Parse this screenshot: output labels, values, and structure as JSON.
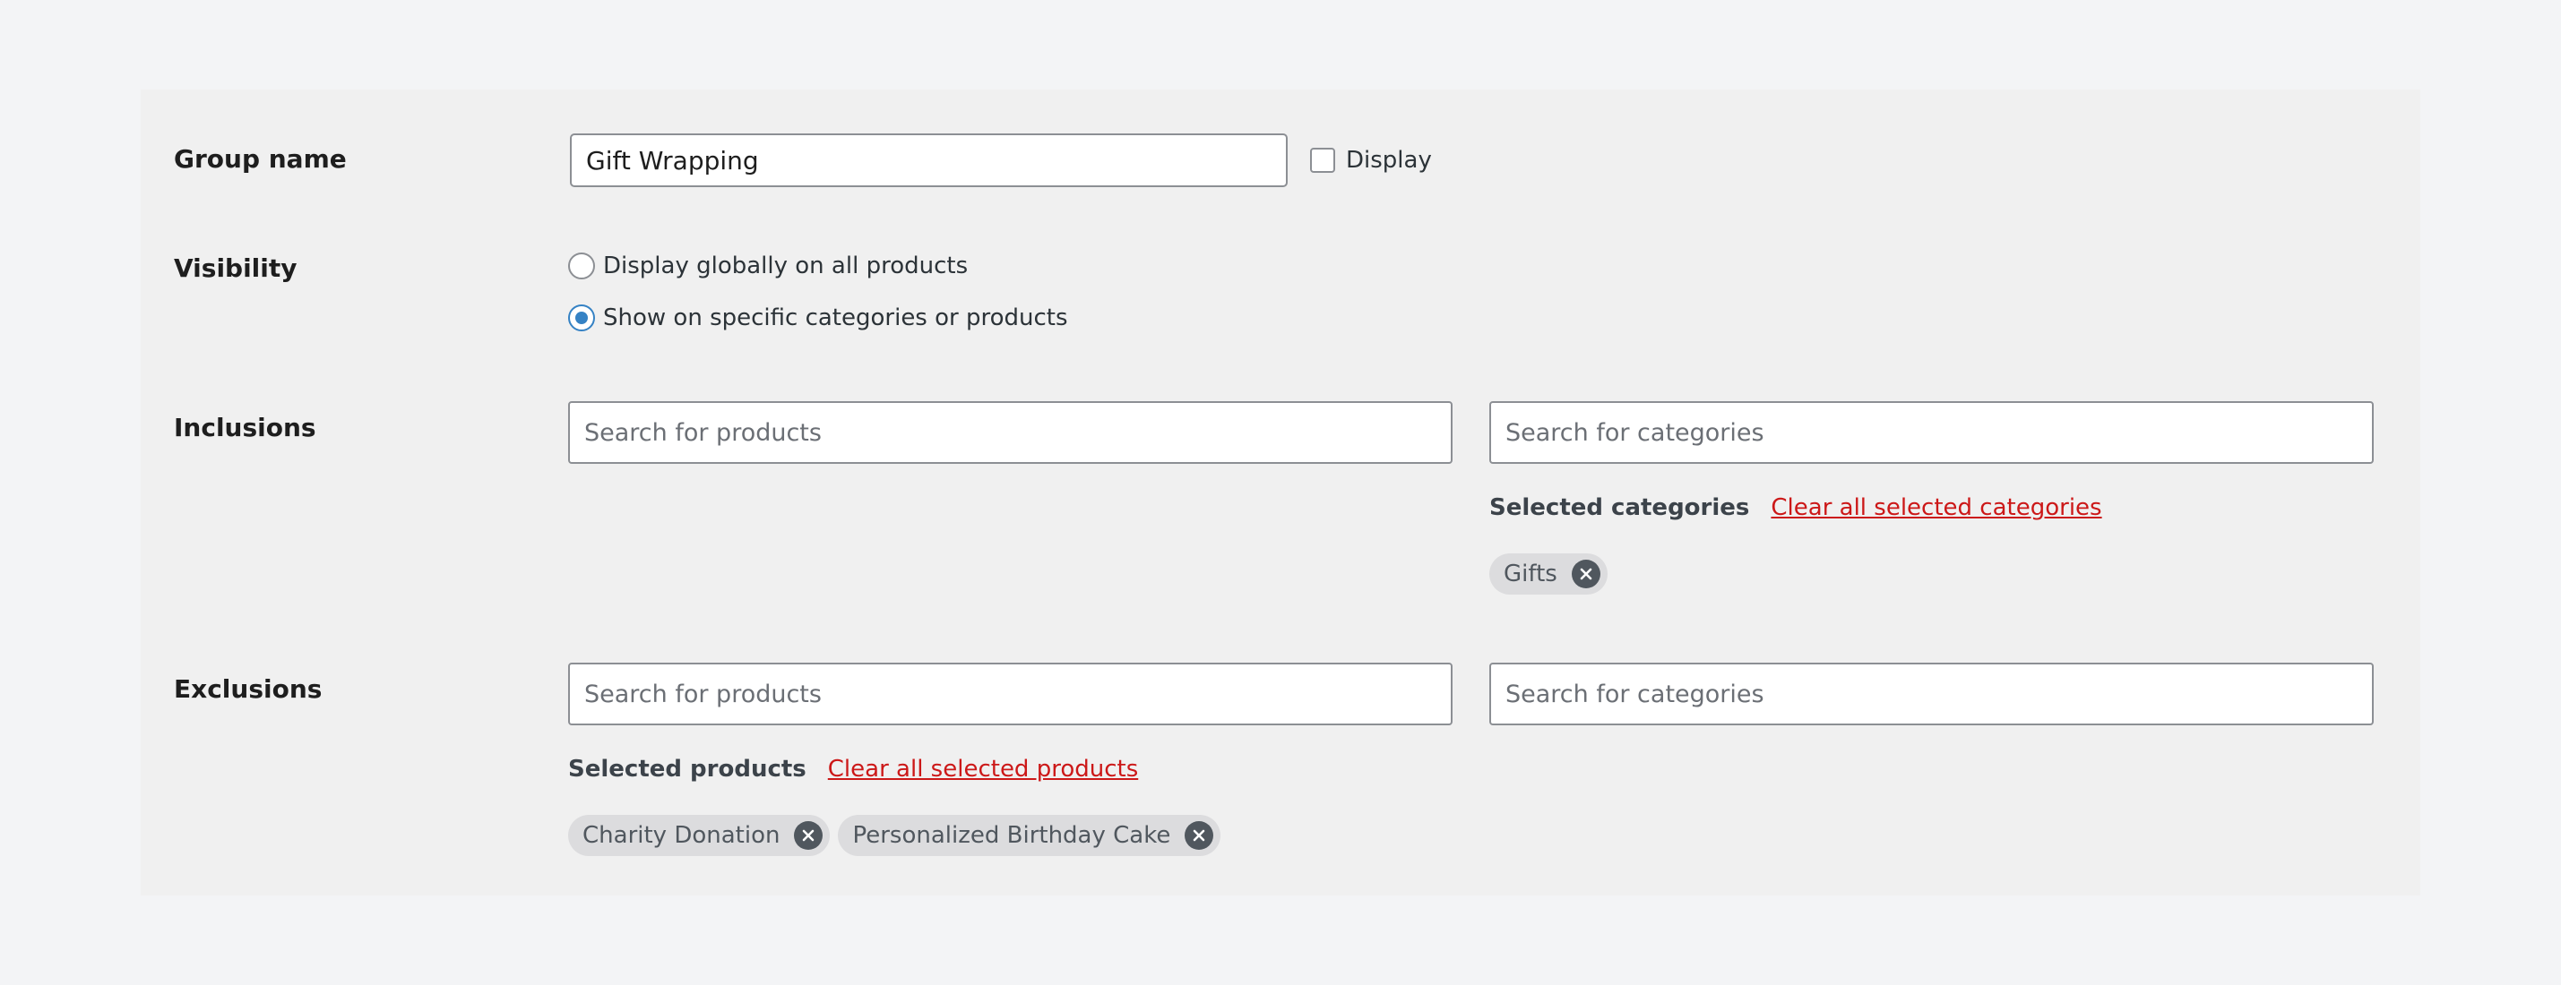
{
  "group": {
    "label": "Group name",
    "name_value": "Gift Wrapping",
    "display_label": "Display",
    "display_checked": false
  },
  "visibility": {
    "label": "Visibility",
    "options": [
      {
        "label": "Display globally on all products",
        "selected": false
      },
      {
        "label": "Show on specific categories or products",
        "selected": true
      }
    ]
  },
  "inclusions": {
    "label": "Inclusions",
    "products_search_placeholder": "Search for products",
    "categories_search_placeholder": "Search for categories",
    "selected_categories_title": "Selected categories",
    "clear_categories_link": "Clear all selected categories",
    "categories": [
      "Gifts"
    ]
  },
  "exclusions": {
    "label": "Exclusions",
    "products_search_placeholder": "Search for products",
    "categories_search_placeholder": "Search for categories",
    "selected_products_title": "Selected products",
    "clear_products_link": "Clear all selected products",
    "products": [
      "Charity Donation",
      "Personalized Birthday Cake"
    ]
  },
  "icons": {
    "chip_remove": "close-circle-icon"
  },
  "colors": {
    "accent": "#3582c4",
    "danger_link": "#cc1818",
    "panel_bg": "#f0f0f0",
    "page_bg": "#f3f4f6"
  }
}
